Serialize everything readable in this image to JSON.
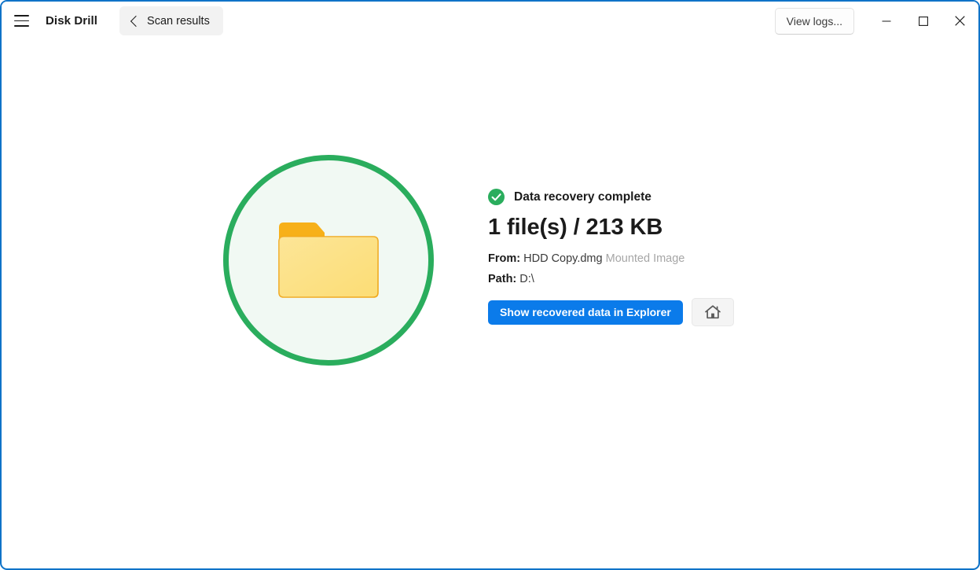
{
  "window": {
    "border_color": "#0f73c8",
    "background": "#ffffff"
  },
  "titlebar": {
    "menu_icon": "hamburger-icon",
    "app_title": "Disk Drill",
    "back_button": {
      "icon": "chevron-left-icon",
      "label": "Scan results"
    },
    "view_logs_label": "View logs...",
    "controls": {
      "minimize": "minimize-icon",
      "maximize": "maximize-icon",
      "close": "close-icon"
    }
  },
  "hero": {
    "icon": "folder-icon",
    "ring_color": "#2aad5d",
    "fill_color": "#f1f9f3",
    "folder_back_color": "#f7b019",
    "folder_front_color": "#fcdd75",
    "folder_border_color": "#f0a81a"
  },
  "result": {
    "status_icon": "check-circle-icon",
    "status_color": "#2aad5d",
    "status_text": "Data recovery complete",
    "headline": "1 file(s) / 213 KB",
    "from_label": "From:",
    "from_value": "HDD Copy.dmg",
    "from_note": "Mounted Image",
    "path_label": "Path:",
    "path_value": "D:\\"
  },
  "actions": {
    "primary_label": "Show recovered data in Explorer",
    "primary_color": "#0b7bea",
    "home_icon": "home-icon"
  }
}
